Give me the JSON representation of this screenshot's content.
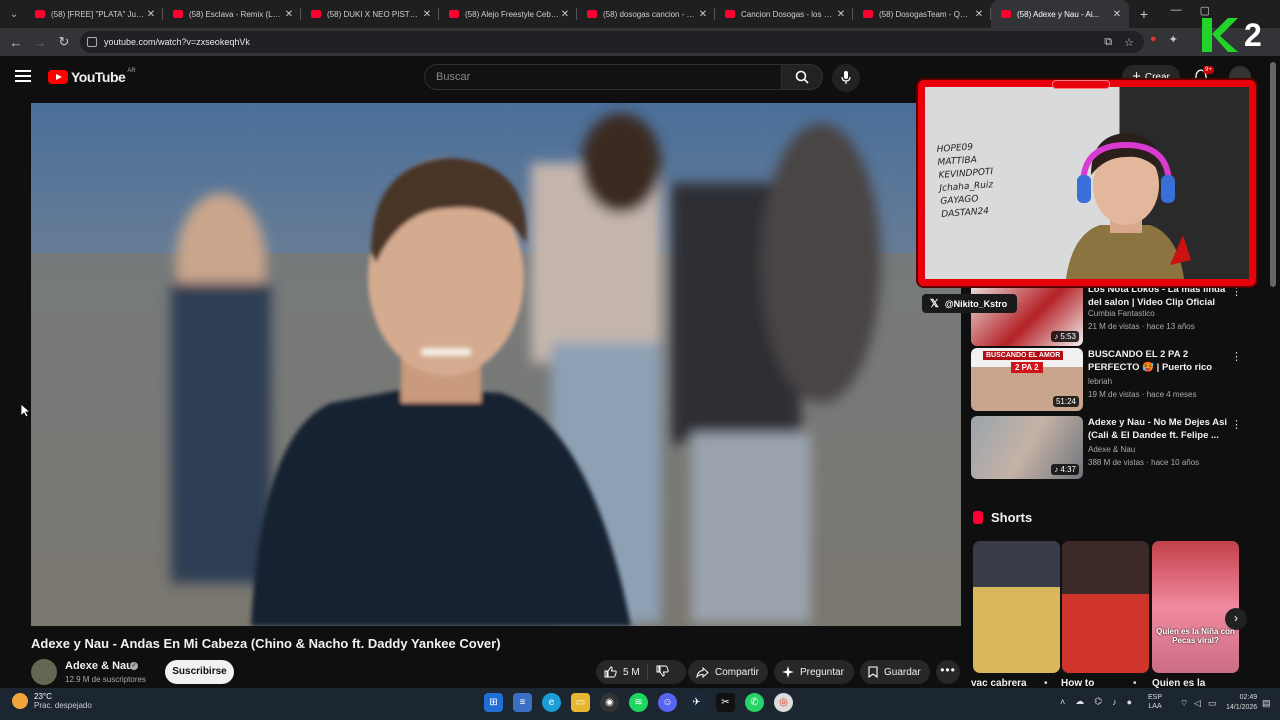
{
  "browser": {
    "tabs": [
      {
        "label": "(58) [FREE] \"PLATA\" Juan...",
        "active": false
      },
      {
        "label": "(58) Esclava - Remix (LETR...",
        "active": false
      },
      {
        "label": "(58) DUKI X NEO PISTEA X...",
        "active": false
      },
      {
        "label": "(58) Alejo Freestyle Cebad...",
        "active": false
      },
      {
        "label": "(58) dosogas cancion - Yo...",
        "active": false
      },
      {
        "label": "Cancion Dosogas - los co...",
        "active": false
      },
      {
        "label": "(58) DosogasTeam - QUE...",
        "active": false
      },
      {
        "label": "(58) Adexe y Nau - Ai...",
        "active": true
      }
    ],
    "url": "youtube.com/watch?v=zxseokeqhVk",
    "overlay_logo": "K2"
  },
  "youtube": {
    "logo_text": "YouTube",
    "country_code": "AR",
    "search_placeholder": "Buscar",
    "create_label": "Crear",
    "notification_count": "9+"
  },
  "video": {
    "title": "Adexe y Nau - Andas En Mi Cabeza (Chino & Nacho ft. Daddy Yankee Cover)",
    "channel": "Adexe & Nau",
    "subscribers": "12.9 M de suscriptores",
    "subscribe_label": "Suscribirse",
    "likes": "5 M",
    "share_label": "Compartir",
    "ask_label": "Preguntar",
    "save_label": "Guardar"
  },
  "stream_overlay": {
    "x_handle": "@Nikito_Kstro",
    "whiteboard_lines": [
      "HOPE09",
      "MATTIBA",
      "KEVINDPOTI",
      "Jchaha_Ruiz",
      "GAYAGO",
      "DASTAN24"
    ]
  },
  "recommendations": [
    {
      "title": "Los Nota Lokos - La mas linda del salon | Video Clip Oficial",
      "channel": "Cumbia Fantastico",
      "meta": "21 M de vistas · hace 13 años",
      "duration": "5:53"
    },
    {
      "title": "BUSCANDO EL 2 PA 2 PERFECTO 🥵 | Puerto rico",
      "channel": "lebriah",
      "meta": "19 M de vistas · hace 4 meses",
      "duration": "51:24",
      "thumb_text": "BUSCANDO EL AMOR",
      "thumb_sub": "2 PA 2"
    },
    {
      "title": "Adexe y Nau - No Me Dejes Asi (Cali & El Dandee ft. Felipe ...",
      "channel": "Adexe & Nau",
      "meta": "388 M de vistas · hace 10 años",
      "duration": "4:37"
    }
  ],
  "shorts": {
    "heading": "Shorts",
    "items": [
      {
        "label": "vac cabrera"
      },
      {
        "label": "How to"
      },
      {
        "label": "Quien es la",
        "thumb_text": "Quien es la Niña con Pecas viral?"
      }
    ]
  },
  "taskbar": {
    "temperature": "23°C",
    "weather": "Prac. despejado",
    "lang_top": "ESP",
    "lang_bottom": "LAA",
    "time": "02:49",
    "date": "14/1/2026"
  },
  "colors": {
    "accent": "#ff0000",
    "webcam_frame": "#e8000b",
    "background": "#0f0f0f"
  }
}
